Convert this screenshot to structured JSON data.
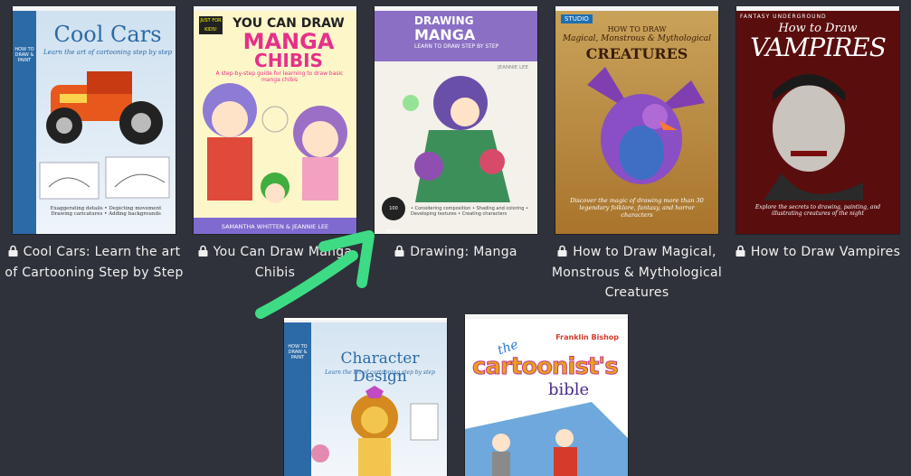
{
  "books": [
    {
      "title": "Cool Cars: Learn the art of Cartooning Step by Step",
      "cover": {
        "series": "HOW TO DRAW & PAINT",
        "headline": "Cool Cars",
        "subline": "Learn the art of cartooning step by step",
        "bullets": "Exaggerating details • Depicting movement  Drawing caricatures • Adding backgrounds"
      }
    },
    {
      "title": "You Can Draw Manga Chibis",
      "cover": {
        "badge": "JUST FOR KIDS!",
        "line1": "YOU CAN DRAW",
        "line2": "MANGA",
        "line3": "CHIBIS",
        "subline": "A step-by-step guide for learning to draw basic manga chibis",
        "authors": "SAMANTHA WHITTEN & JEANNIE LEE"
      }
    },
    {
      "title": "Drawing: Manga",
      "cover": {
        "line1": "DRAWING",
        "line2": "MANGA",
        "subline": "LEARN TO DRAW STEP BY STEP",
        "author": "JEANNIE LEE",
        "bullets": "• Considering composition • Shading and coloring  • Developing textures • Creating characters",
        "badge": "100 YEARS"
      }
    },
    {
      "title": "How to Draw Magical, Monstrous & Mythological Creatures",
      "cover": {
        "badge": "STUDIO",
        "line1": "HOW TO DRAW",
        "line2": "Magical, Monstrous & Mythological",
        "line3": "CREATURES",
        "subline": "Discover the magic of drawing more than 30 legendary folklore, fantasy, and horror characters"
      }
    },
    {
      "title": "How to Draw Vampires",
      "cover": {
        "series": "FANTASY UNDERGROUND",
        "line1": "How to Draw",
        "line2": "VAMPIRES",
        "subline": "Explore the secrets to drawing, painting, and illustrating creatures of the night"
      }
    },
    {
      "title": "",
      "cover": {
        "series": "HOW TO DRAW & PAINT",
        "headline": "Character Design",
        "subline": "Learn the art of cartooning step by step"
      }
    },
    {
      "title": "",
      "cover": {
        "author": "Franklin Bishop",
        "line1": "the",
        "line2": "cartoonist's",
        "line3": "bible"
      }
    }
  ],
  "icons": {
    "lock": "lock-icon",
    "arrow": "green-arrow-annotation"
  },
  "colors": {
    "background": "#2f323a",
    "caption": "#f0f0f0",
    "arrow": "#3ddc84"
  }
}
